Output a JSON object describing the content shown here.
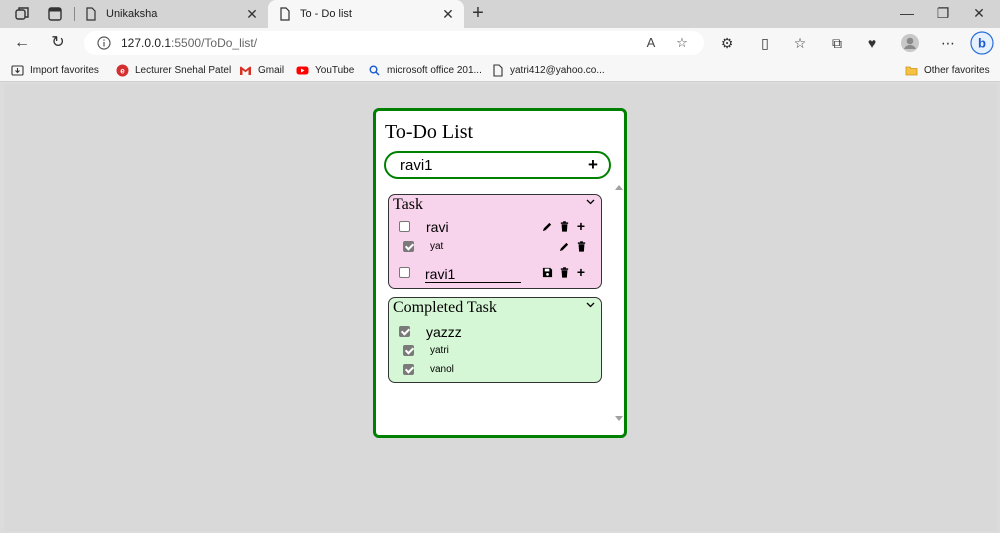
{
  "browser": {
    "tabs": [
      {
        "title": "Unikaksha",
        "active": false
      },
      {
        "title": "To - Do list",
        "active": true
      }
    ],
    "url_host": "127.0.0.1",
    "url_rest": ":5500/ToDo_list/",
    "favorites": [
      {
        "label": "Import favorites",
        "icon": "import-icon"
      },
      {
        "label": "Lecturer Snehal Patel",
        "icon": "site-red-icon"
      },
      {
        "label": "Gmail",
        "icon": "gmail-icon"
      },
      {
        "label": "YouTube",
        "icon": "youtube-icon"
      },
      {
        "label": "microsoft office 201...",
        "icon": "search-icon"
      },
      {
        "label": "yatri412@yahoo.co...",
        "icon": "page-icon"
      }
    ],
    "other_favorites": "Other favorites"
  },
  "app": {
    "title": "To-Do List",
    "input_value": "ravi1",
    "add_symbol": "+",
    "task_panel": {
      "heading": "Task",
      "color": "#f8d4ec",
      "items": [
        {
          "label": "ravi",
          "checked": false,
          "editing": false,
          "subtasks": [
            {
              "label": "yat",
              "checked": true
            }
          ]
        },
        {
          "label": "ravi1",
          "checked": false,
          "editing": true,
          "subtasks": []
        }
      ]
    },
    "completed_panel": {
      "heading": "Completed Task",
      "color": "#d6f7d6",
      "items": [
        {
          "label": "yazzz",
          "checked": true,
          "subtasks": [
            {
              "label": "yatri",
              "checked": true
            },
            {
              "label": "vanol",
              "checked": true
            }
          ]
        }
      ]
    },
    "accent": "#008000"
  }
}
